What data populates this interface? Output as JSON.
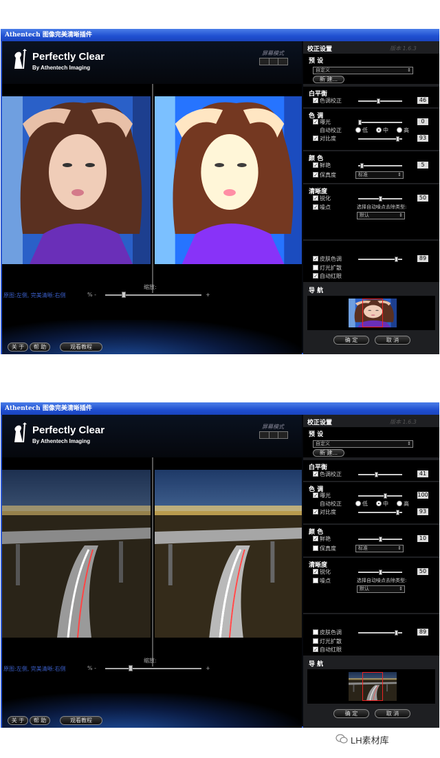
{
  "windows": [
    {
      "title": "Athentech 图像完美清晰插件",
      "brand": "Perfectly Clear",
      "brand_sub": "By Athentech Imaging",
      "screen_mode": "屏幕模式",
      "zoom_label": "缩放:",
      "caption": "原图:左侧, 完美清晰:右侧",
      "zoom_pct": "% -",
      "zoom_plus": "+",
      "zoom_pos": 0.18,
      "btn_about": "关 于",
      "btn_help": "帮 助",
      "btn_tutorial": "观看教程",
      "panel_title": "校正设置",
      "version": "版本 1.6.3",
      "preset_h": "预 设",
      "preset_val": "自定义",
      "new_btn": "新 建...",
      "wb_h": "白平衡",
      "wb_label": "色调校正",
      "wb_val": "46",
      "wb_pos": 0.46,
      "wb_checked": true,
      "tone_h": "色 调",
      "exp_label": "曝光",
      "exp_val": "0",
      "exp_pos": 0.0,
      "exp_checked": true,
      "auto_label": "自动校正",
      "r_low": "低",
      "r_mid": "中",
      "r_high": "高",
      "contrast_label": "对比度",
      "contrast_val": "93",
      "contrast_pos": 0.93,
      "contrast_checked": true,
      "color_h": "颜 色",
      "vivid_label": "鲜艳",
      "vivid_val": "5",
      "vivid_pos": 0.05,
      "vivid_checked": true,
      "true_label": "保真度",
      "true_sel": "标准",
      "true_checked": true,
      "sharp_h": "清晰度",
      "sharp_label": "锐化",
      "sharp_val": "50",
      "sharp_pos": 0.5,
      "sharp_checked": true,
      "noise_label": "噪点",
      "noise_checked": true,
      "noise_type_label": "选择自动噪点去除类型:",
      "noise_sel": "默认",
      "skin_label": "皮肤色调",
      "skin_val": "89",
      "skin_pos": 0.89,
      "skin_checked": true,
      "light_label": "灯光扩散",
      "light_checked": false,
      "redeye_label": "自动红眼",
      "redeye_checked": true,
      "nav_h": "导 航",
      "ok_btn": "确 定",
      "cancel_btn": "取 消",
      "scene": "portrait"
    },
    {
      "title": "Athentech 图像完美清晰插件",
      "brand": "Perfectly Clear",
      "brand_sub": "By Athentech Imaging",
      "screen_mode": "屏幕模式",
      "zoom_label": "缩放:",
      "caption": "原图:左侧, 完美清晰:右侧",
      "zoom_pct": "% -",
      "zoom_plus": "+",
      "zoom_pos": 0.25,
      "btn_about": "关 于",
      "btn_help": "帮 助",
      "btn_tutorial": "观看教程",
      "panel_title": "校正设置",
      "version": "版本 1.6.3",
      "preset_h": "预 设",
      "preset_val": "自定义",
      "new_btn": "新 建...",
      "wb_h": "白平衡",
      "wb_label": "色调校正",
      "wb_val": "41",
      "wb_pos": 0.41,
      "wb_checked": true,
      "tone_h": "色 调",
      "exp_label": "曝光",
      "exp_val": "100",
      "exp_pos": 0.62,
      "exp_checked": true,
      "auto_label": "自动校正",
      "r_low": "低",
      "r_mid": "中",
      "r_high": "高",
      "contrast_label": "对比度",
      "contrast_val": "93",
      "contrast_pos": 0.93,
      "contrast_checked": true,
      "color_h": "颜 色",
      "vivid_label": "鲜艳",
      "vivid_val": "10",
      "vivid_pos": 0.5,
      "vivid_checked": true,
      "true_label": "保真度",
      "true_sel": "标准",
      "true_checked": false,
      "sharp_h": "清晰度",
      "sharp_label": "锐化",
      "sharp_val": "50",
      "sharp_pos": 0.5,
      "sharp_checked": true,
      "noise_label": "噪点",
      "noise_checked": false,
      "noise_type_label": "选择自动噪点去除类型:",
      "noise_sel": "默认",
      "skin_label": "皮肤色调",
      "skin_val": "89",
      "skin_pos": 0.89,
      "skin_checked": false,
      "light_label": "灯光扩散",
      "light_checked": false,
      "redeye_label": "自动红眼",
      "redeye_checked": true,
      "nav_h": "导 航",
      "ok_btn": "确 定",
      "cancel_btn": "取 消",
      "scene": "highway"
    }
  ],
  "watermark": "LH素材库"
}
